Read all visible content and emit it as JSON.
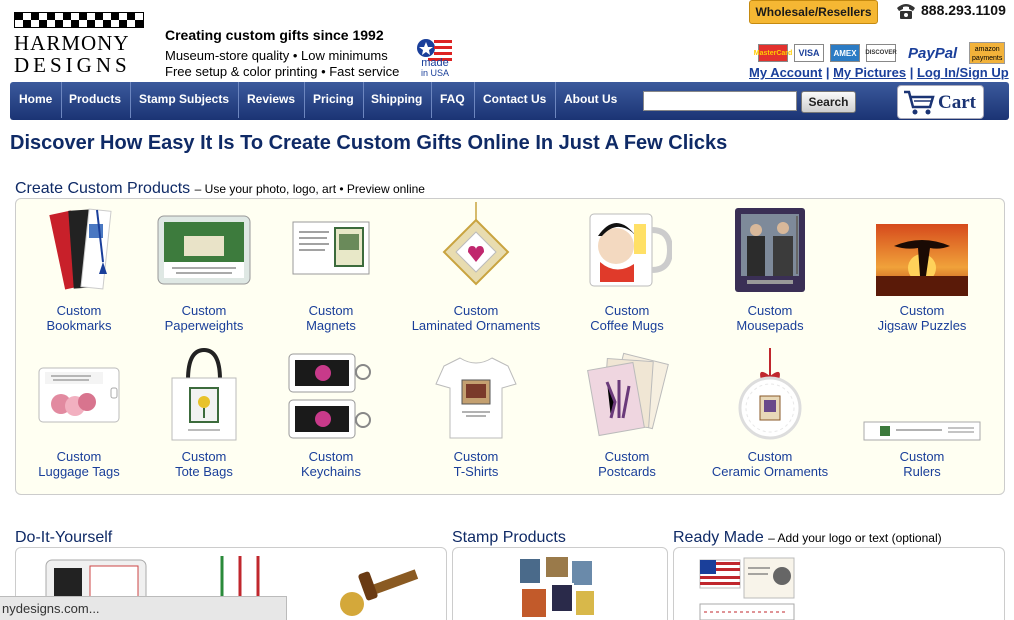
{
  "header": {
    "logo_line1": "HARMONY",
    "logo_line2": "DESIGNS",
    "tagline": "Creating custom gifts since 1992",
    "features_line1": "Museum-store quality • Low minimums",
    "features_line2": "Free setup & color printing • Fast service",
    "made_in": "made",
    "made_in_usa": "in USA",
    "wholesale_label": "Wholesale/Resellers",
    "phone": "888.293.1109",
    "payment_cards": [
      "MasterCard",
      "VISA",
      "AMEX",
      "DISCOVER"
    ],
    "paypal": "PayPal",
    "amazon": "amazon payments",
    "account_links": {
      "my_account": "My Account",
      "my_pictures": "My Pictures",
      "login": "Log In/Sign Up"
    }
  },
  "nav": {
    "items": [
      "Home",
      "Products",
      "Stamp Subjects",
      "Reviews",
      "Pricing",
      "Shipping",
      "FAQ",
      "Contact Us",
      "About Us"
    ],
    "search_placeholder": "",
    "search_button": "Search",
    "cart_label": "Cart"
  },
  "headline": "Discover How Easy It Is To Create Custom Gifts Online In Just A Few Clicks",
  "custom_section": {
    "title": "Create Custom Products",
    "subtitle": "– Use your photo, logo, art • Preview online",
    "products": [
      {
        "line1": "Custom",
        "line2": "Bookmarks"
      },
      {
        "line1": "Custom",
        "line2": "Paperweights"
      },
      {
        "line1": "Custom",
        "line2": "Magnets"
      },
      {
        "line1": "Custom",
        "line2": "Laminated Ornaments"
      },
      {
        "line1": "Custom",
        "line2": "Coffee Mugs"
      },
      {
        "line1": "Custom",
        "line2": "Mousepads"
      },
      {
        "line1": "Custom",
        "line2": "Jigsaw Puzzles"
      },
      {
        "line1": "Custom",
        "line2": "Luggage Tags"
      },
      {
        "line1": "Custom",
        "line2": "Tote Bags"
      },
      {
        "line1": "Custom",
        "line2": "Keychains"
      },
      {
        "line1": "Custom",
        "line2": "T-Shirts"
      },
      {
        "line1": "Custom",
        "line2": "Postcards"
      },
      {
        "line1": "Custom",
        "line2": "Ceramic Ornaments"
      },
      {
        "line1": "Custom",
        "line2": "Rulers"
      }
    ]
  },
  "diy_section": {
    "title": "Do-It-Yourself"
  },
  "stamp_section": {
    "title": "Stamp Products"
  },
  "ready_section": {
    "title": "Ready Made",
    "subtitle": "– Add your logo or text (optional)"
  },
  "status_bar": "nydesigns.com...",
  "colors": {
    "nav_blue": "#1b3474",
    "link_blue": "#1a3f9a",
    "box_bg": "#fffff2",
    "wholesale_orange": "#f5b733"
  }
}
